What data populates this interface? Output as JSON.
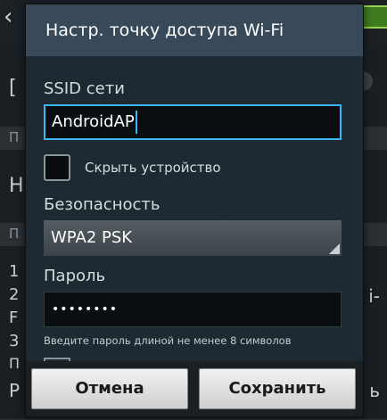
{
  "background": {
    "back_glyph": "‹",
    "letters": {
      "row1": "[",
      "sect1": "П",
      "row2": "Н",
      "sect2": "П",
      "line1": "1",
      "line2": "2",
      "line3": "F",
      "line4": "3",
      "line5": "П",
      "line6": "Р"
    },
    "right_fragments": [
      "i-",
      "ь"
    ]
  },
  "dialog": {
    "title": "Настр. точку доступа Wi-Fi",
    "ssid": {
      "label": "SSID сети",
      "value": "AndroidAP"
    },
    "hide_device": {
      "label": "Скрыть устройство",
      "checked": false
    },
    "security": {
      "label": "Безопасность",
      "value": "WPA2 PSK"
    },
    "password": {
      "label": "Пароль",
      "value": "••••••••",
      "hint": "Введите пароль длиной не менее 8 символов"
    },
    "buttons": {
      "cancel": "Отмена",
      "save": "Сохранить"
    }
  },
  "colors": {
    "header": "#38495a",
    "focus": "#3bb6f0",
    "dialog_bg": "#1d2a31"
  }
}
